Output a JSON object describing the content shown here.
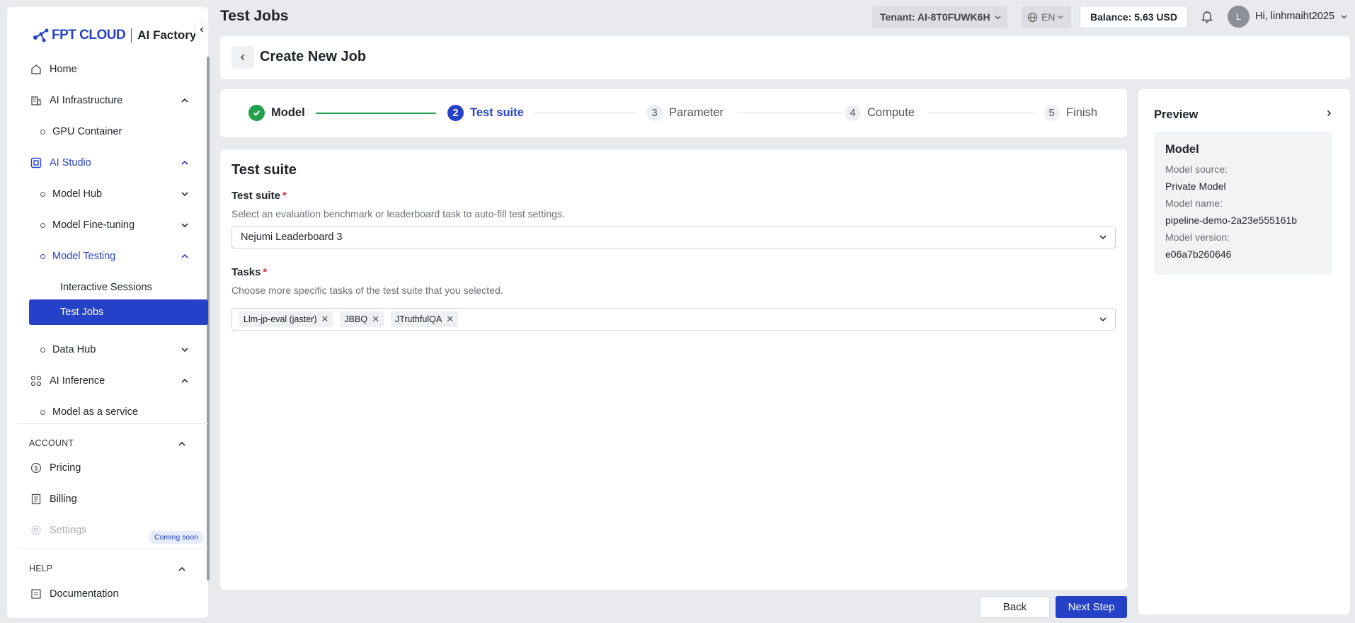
{
  "brand": {
    "logo_text": "FPT CLOUD",
    "product": "AI Factory"
  },
  "sidebar": {
    "items": {
      "home": "Home",
      "ai_infrastructure": "AI Infrastructure",
      "gpu_container": "GPU Container",
      "ai_studio": "AI Studio",
      "model_hub": "Model Hub",
      "model_fine_tuning": "Model Fine-tuning",
      "model_testing": "Model Testing",
      "interactive_sessions": "Interactive Sessions",
      "test_jobs": "Test Jobs",
      "data_hub": "Data Hub",
      "ai_inference": "AI Inference",
      "model_as_service": "Model as a service"
    },
    "account": {
      "title": "ACCOUNT",
      "pricing": "Pricing",
      "billing": "Billing",
      "settings": "Settings",
      "coming_soon": "Coming soon"
    },
    "help": {
      "title": "HELP",
      "documentation": "Documentation"
    }
  },
  "topbar": {
    "page_title": "Test Jobs",
    "tenant": "Tenant: AI-8T0FUWK6H",
    "language": "EN",
    "balance": "Balance: 5.63 USD",
    "avatar_initial": "L",
    "greeting": "Hi, linhmaiht2025"
  },
  "header": {
    "title": "Create New Job"
  },
  "steps": [
    {
      "num": "1",
      "label": "Model",
      "state": "done"
    },
    {
      "num": "2",
      "label": "Test suite",
      "state": "current"
    },
    {
      "num": "3",
      "label": "Parameter",
      "state": "pending"
    },
    {
      "num": "4",
      "label": "Compute",
      "state": "pending"
    },
    {
      "num": "5",
      "label": "Finish",
      "state": "pending"
    }
  ],
  "form": {
    "title": "Test suite",
    "test_suite": {
      "label": "Test suite",
      "required": "*",
      "help": "Select an evaluation benchmark or leaderboard task to auto-fill test settings.",
      "value": "Nejumi Leaderboard 3"
    },
    "tasks": {
      "label": "Tasks",
      "required": "*",
      "help": "Choose more specific tasks of the test suite that you selected.",
      "tags": [
        "Llm-jp-eval (jaster)",
        "JBBQ",
        "JTruthfulQA"
      ]
    }
  },
  "preview": {
    "title": "Preview",
    "section": "Model",
    "model_source_label": "Model source:",
    "model_source": "Private Model",
    "model_name_label": "Model name:",
    "model_name": "pipeline-demo-2a23e555161b",
    "model_version_label": "Model version:",
    "model_version": "e06a7b260646"
  },
  "footer": {
    "back": "Back",
    "next": "Next Step"
  },
  "colors": {
    "primary": "#2541c8",
    "success": "#22a04b",
    "required": "#e0283c"
  }
}
